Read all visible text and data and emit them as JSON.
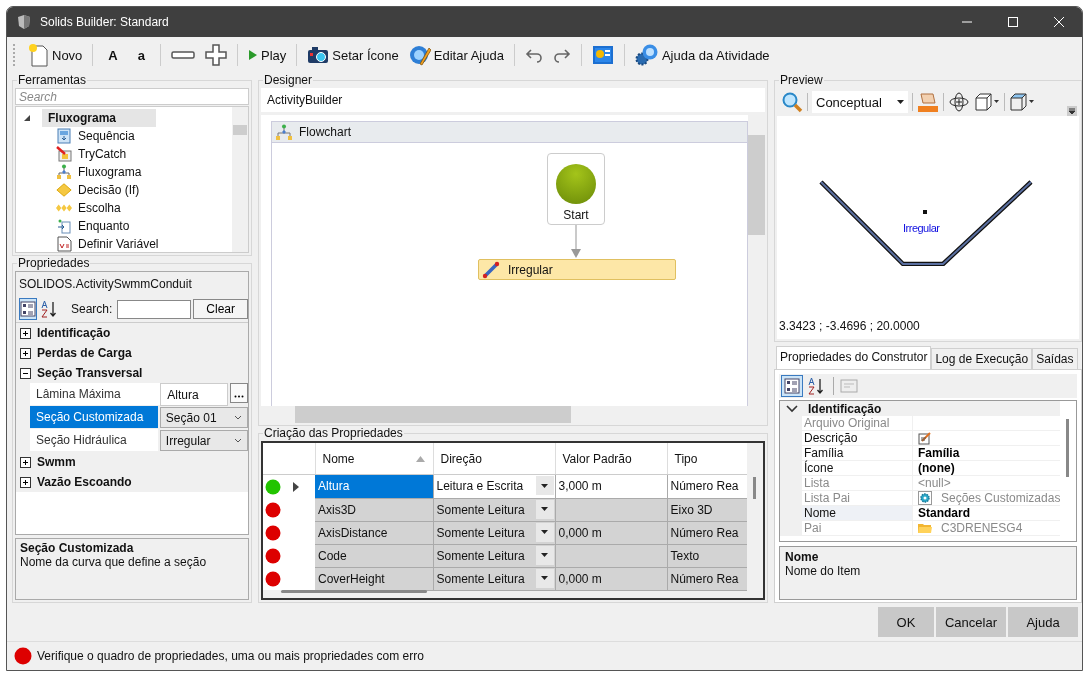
{
  "window": {
    "title": "Solids Builder: Standard"
  },
  "toolbar": [
    [
      {
        "kind": "new",
        "label": "Novo"
      }
    ],
    [
      {
        "kind": "letter",
        "label": "A"
      },
      {
        "kind": "letter",
        "label": "a"
      }
    ],
    [
      {
        "kind": "minus"
      },
      {
        "kind": "plus"
      }
    ],
    [
      {
        "kind": "play",
        "label": "Play"
      }
    ],
    [
      {
        "kind": "camera",
        "label": "Setar Ícone"
      },
      {
        "kind": "help-edit",
        "label": "Editar Ajuda"
      }
    ],
    [
      {
        "kind": "undo"
      },
      {
        "kind": "redo"
      }
    ],
    [
      {
        "kind": "image"
      }
    ],
    [
      {
        "kind": "help",
        "label": "Ajuda da Atividade"
      }
    ]
  ],
  "ferramentas": {
    "title": "Ferramentas",
    "search": {
      "placeholder": "Search"
    },
    "tree": [
      {
        "label": "Fluxograma",
        "expanded": true,
        "selected": true,
        "children": [
          {
            "label": "Sequência"
          },
          {
            "label": "TryCatch"
          },
          {
            "label": "Fluxograma"
          },
          {
            "label": "Decisão (If)"
          },
          {
            "label": "Escolha"
          },
          {
            "label": "Enquanto"
          },
          {
            "label": "Definir Variável"
          }
        ]
      }
    ]
  },
  "propriedades": {
    "title": "Propriedades",
    "object": "SOLIDOS.ActivitySwmmConduit",
    "sort_modes": [
      {
        "kind": "categorized",
        "selected": true
      },
      {
        "kind": "alphabetical",
        "selected": false
      }
    ],
    "search_label": "Search:",
    "clear": "Clear",
    "categories": [
      {
        "label": "Identificação",
        "expanded": false
      },
      {
        "label": "Perdas de Carga",
        "expanded": false
      },
      {
        "label": "Seção Transversal",
        "expanded": true,
        "children": [
          {
            "name": "Lâmina Máxima",
            "value": "Altura",
            "kind": "ellipsis",
            "selected": false
          },
          {
            "name": "Seção Customizada",
            "value": "Seção 01",
            "kind": "dropdown",
            "selected": true
          },
          {
            "name": "Seção Hidráulica",
            "value": "Irregular",
            "kind": "dropdown",
            "selected": false
          }
        ]
      },
      {
        "label": "Swmm",
        "expanded": false
      },
      {
        "label": "Vazão Escoando",
        "expanded": false
      }
    ],
    "help": {
      "title": "Seção Customizada",
      "text": "Nome da curva que define a seção"
    }
  },
  "designer": {
    "title": "Designer",
    "breadcrumb": "ActivityBuilder",
    "flowchart": {
      "title": "Flowchart",
      "start": "Start",
      "activity": "Irregular"
    }
  },
  "criacao": {
    "title": "Criação das Propriedades",
    "columns": [
      {
        "label": "Nome",
        "sorted": true
      },
      {
        "label": "Direção",
        "sorted": false
      },
      {
        "label": "Valor Padrão",
        "sorted": false
      },
      {
        "label": "Tipo",
        "sorted": false
      }
    ],
    "rows": [
      {
        "color": "#22c400",
        "selected": true,
        "nome": "Altura",
        "direcao": "Leitura e Escrita",
        "valor": "3,000 m",
        "tipo": "Número Rea"
      },
      {
        "color": "#dd0000",
        "selected": false,
        "nome": "Axis3D",
        "direcao": "Somente Leitura",
        "tipo": "Eixo 3D"
      },
      {
        "color": "#dd0000",
        "selected": false,
        "nome": "AxisDistance",
        "direcao": "Somente Leitura",
        "valor": "0,000 m",
        "tipo": "Número Rea"
      },
      {
        "color": "#dd0000",
        "selected": false,
        "nome": "Code",
        "direcao": "Somente Leitura",
        "tipo": "Texto"
      },
      {
        "color": "#dd0000",
        "selected": false,
        "nome": "CoverHeight",
        "direcao": "Somente Leitura",
        "valor": "0,000 m",
        "tipo": "Número Rea"
      }
    ]
  },
  "preview": {
    "title": "Preview",
    "view_mode": "Conceptual",
    "label": "Irregular",
    "coordinates": "3.3423 ; -3.4696 ; 20.0000"
  },
  "builder_tabs": [
    {
      "label": "Propriedades do Construtor",
      "selected": true
    },
    {
      "label": "Log de Execução",
      "selected": false
    },
    {
      "label": "Saídas",
      "selected": false
    }
  ],
  "builder_grid": {
    "category": "Identificação",
    "expanded": true,
    "rows": [
      {
        "kind": "text",
        "name": "Arquivo Original",
        "disabled": true,
        "selected": false
      },
      {
        "kind": "edit",
        "name": "Descrição",
        "disabled": false,
        "selected": false
      },
      {
        "kind": "text",
        "name": "Família",
        "value": "Família",
        "disabled": false,
        "modified": true,
        "selected": false
      },
      {
        "kind": "text",
        "name": "Ícone",
        "value": "(none)",
        "disabled": false,
        "modified": true,
        "selected": false
      },
      {
        "kind": "text",
        "name": "Lista",
        "value": "<null>",
        "disabled": true,
        "modified": false,
        "selected": false
      },
      {
        "kind": "link",
        "name": "Lista Pai",
        "value": "Seções Customizadas",
        "disabled": true,
        "modified": false,
        "selected": false
      },
      {
        "kind": "text",
        "name": "Nome",
        "value": "Standard",
        "disabled": false,
        "modified": true,
        "selected": true
      },
      {
        "kind": "folder",
        "name": "Pai",
        "value": "C3DRENESG4",
        "disabled": true,
        "modified": false,
        "selected": false
      }
    ]
  },
  "builder_help": {
    "title": "Nome",
    "text": "Nome do Item"
  },
  "buttons": [
    "OK",
    "Cancelar",
    "Ajuda"
  ],
  "status_bar": {
    "text": "Verifique o quadro de propriedades, uma ou mais propriedades com erro"
  }
}
